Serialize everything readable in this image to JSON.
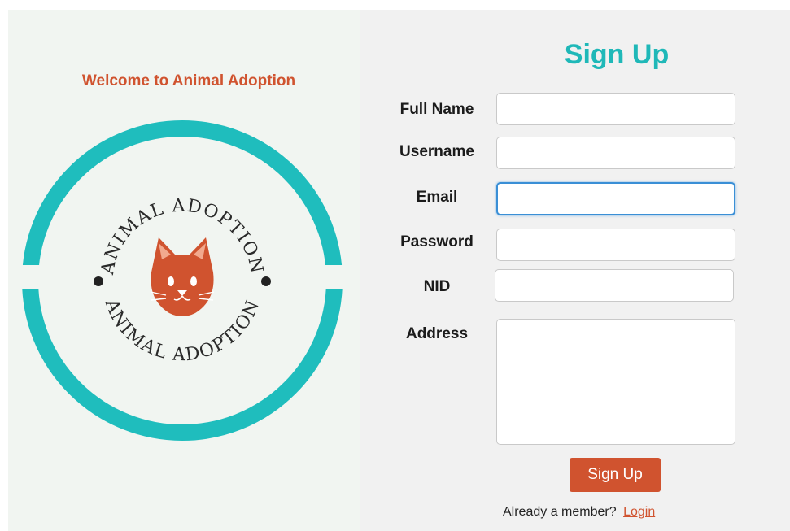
{
  "welcome_text": "Welcome to Animal Adoption",
  "logo": {
    "top_text": "ANIMAL ADOPTION",
    "bottom_text": "ANIMAL ADOPTION",
    "ring_color": "#1fbdbd",
    "cat_color": "#d0532f"
  },
  "form": {
    "title": "Sign Up",
    "fields": {
      "full_name": {
        "label": "Full Name",
        "value": ""
      },
      "username": {
        "label": "Username",
        "value": ""
      },
      "email": {
        "label": "Email",
        "value": ""
      },
      "password": {
        "label": "Password",
        "value": ""
      },
      "nid": {
        "label": "NID",
        "value": ""
      },
      "address": {
        "label": "Address",
        "value": ""
      }
    },
    "submit_label": "Sign Up",
    "member_text": "Already a member?",
    "login_link": "Login"
  },
  "colors": {
    "accent": "#1fb8b8",
    "primary": "#d0532f",
    "focus": "#3a8fd6"
  }
}
